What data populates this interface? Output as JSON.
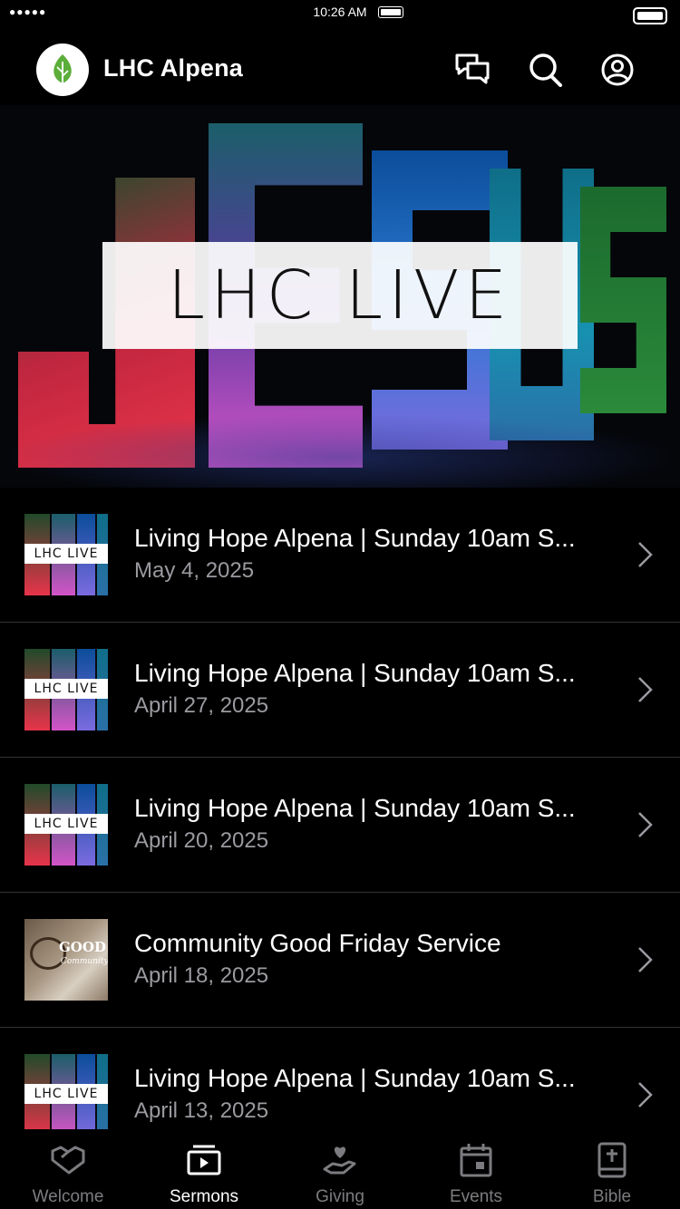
{
  "status_bar": {
    "signal": "●●●●● ",
    "time": "10:26 AM"
  },
  "header": {
    "title": "LHC Alpena",
    "icons": [
      "chat-icon",
      "search-icon",
      "profile-icon"
    ]
  },
  "hero": {
    "banner_text": "LHC LIVE"
  },
  "sermons": [
    {
      "title": "Living Hope Alpena | Sunday 10am S...",
      "date": "May 4, 2025",
      "thumb_label": "LHC LIVE"
    },
    {
      "title": "Living Hope Alpena | Sunday 10am S...",
      "date": "April 27, 2025",
      "thumb_label": "LHC LIVE"
    },
    {
      "title": "Living Hope Alpena | Sunday 10am S...",
      "date": "April 20, 2025",
      "thumb_label": "LHC LIVE"
    },
    {
      "title": "Community Good Friday Service",
      "date": "April 18, 2025",
      "thumb_label": "GOOD FR",
      "thumb_sub": "Community W"
    },
    {
      "title": "Living Hope Alpena | Sunday 10am S...",
      "date": "April 13, 2025",
      "thumb_label": "LHC LIVE"
    }
  ],
  "tabs": [
    {
      "label": "Welcome",
      "icon": "handshake-icon",
      "active": false
    },
    {
      "label": "Sermons",
      "icon": "play-icon",
      "active": true
    },
    {
      "label": "Giving",
      "icon": "giving-icon",
      "active": false
    },
    {
      "label": "Events",
      "icon": "calendar-icon",
      "active": false
    },
    {
      "label": "Bible",
      "icon": "bible-icon",
      "active": false
    }
  ],
  "colors": {
    "background": "#000000",
    "text": "#ffffff",
    "muted": "#9a9aa0",
    "tab_inactive": "#7c7c80",
    "logo_green": "#5cae3a"
  }
}
